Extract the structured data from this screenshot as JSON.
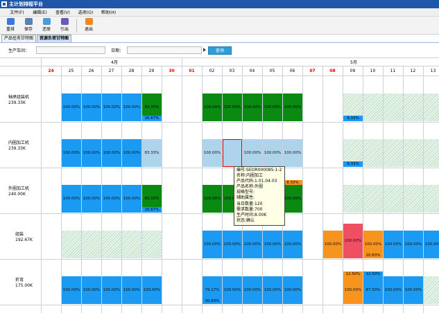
{
  "window": {
    "title": "主计划排程平台"
  },
  "menu": [
    "文件(F)",
    "编辑(E)",
    "查看(V)",
    "选项(O)",
    "帮助(H)"
  ],
  "toolbar": [
    {
      "label": "重排",
      "icon": "refresh-icon",
      "color": "#3a7bd5"
    },
    {
      "label": "保存",
      "icon": "save-icon",
      "color": "#5a7fb0"
    },
    {
      "label": "还原",
      "icon": "undo-icon",
      "color": "#4e9ad8"
    },
    {
      "label": "引出",
      "icon": "export-icon",
      "color": "#6a5ab8"
    },
    {
      "label": "退出",
      "icon": "exit-icon",
      "color": "#e88b2c"
    }
  ],
  "tabs": [
    {
      "label": "产品任务甘特图",
      "active": false
    },
    {
      "label": "资源负荷甘特图",
      "active": true
    }
  ],
  "filter": {
    "workshop_label": "生产车间：",
    "workshop_value": "",
    "date_label": "日期：",
    "date_value": "",
    "query_label": "查询"
  },
  "calendar": {
    "months": [
      {
        "label": "4月"
      },
      {
        "label": "5月"
      }
    ],
    "days": [
      {
        "label": "24",
        "red": true
      },
      {
        "label": "25",
        "red": false
      },
      {
        "label": "26",
        "red": false
      },
      {
        "label": "27",
        "red": false
      },
      {
        "label": "28",
        "red": false
      },
      {
        "label": "29",
        "red": false
      },
      {
        "label": "30",
        "red": true
      },
      {
        "label": "01",
        "red": true
      },
      {
        "label": "02",
        "red": false
      },
      {
        "label": "03",
        "red": false
      },
      {
        "label": "04",
        "red": false
      },
      {
        "label": "05",
        "red": false
      },
      {
        "label": "06",
        "red": false
      },
      {
        "label": "07",
        "red": true
      },
      {
        "label": "08",
        "red": true
      },
      {
        "label": "09",
        "red": false
      },
      {
        "label": "10",
        "red": false
      },
      {
        "label": "11",
        "red": false
      },
      {
        "label": "12",
        "red": false
      },
      {
        "label": "13",
        "red": false
      }
    ]
  },
  "machines": [
    {
      "name": "轴承组装机",
      "capacity": "239.33K",
      "cells": [
        {
          "day": 1,
          "type": "blue",
          "text": "100.00%"
        },
        {
          "day": 2,
          "type": "blue",
          "text": "100.00%"
        },
        {
          "day": 3,
          "type": "blue",
          "text": "100.00%"
        },
        {
          "day": 4,
          "type": "blue",
          "text": "100.00%"
        },
        {
          "day": 5,
          "type": "green",
          "text": "83.33%",
          "sub": {
            "type": "blue",
            "text": "16.67%"
          }
        },
        {
          "day": 8,
          "type": "green",
          "text": "100.00%"
        },
        {
          "day": 9,
          "type": "green",
          "text": "100.00%"
        },
        {
          "day": 10,
          "type": "green",
          "text": "100.00%"
        },
        {
          "day": 11,
          "type": "green",
          "text": "100.00%"
        },
        {
          "day": 12,
          "type": "green",
          "text": "100.00%"
        },
        {
          "day": 15,
          "type": "hatch",
          "text": "",
          "sub": {
            "type": "blue",
            "text": "9.33%"
          }
        },
        {
          "day": 16,
          "type": "hatch",
          "text": ""
        },
        {
          "day": 17,
          "type": "hatch",
          "text": ""
        },
        {
          "day": 18,
          "type": "hatch",
          "text": ""
        },
        {
          "day": 19,
          "type": "hatch",
          "text": ""
        }
      ]
    },
    {
      "name": "内圈加工机",
      "capacity": "239.33K",
      "cells": [
        {
          "day": 1,
          "type": "blue",
          "text": "100.00%"
        },
        {
          "day": 2,
          "type": "blue",
          "text": "100.00%"
        },
        {
          "day": 3,
          "type": "blue",
          "text": "100.00%"
        },
        {
          "day": 4,
          "type": "blue",
          "text": "100.00%"
        },
        {
          "day": 5,
          "type": "lightblue",
          "text": "83.33%"
        },
        {
          "day": 8,
          "type": "lightblue",
          "text": "100.00%"
        },
        {
          "day": 9,
          "type": "lightblue",
          "text": "",
          "selected": true
        },
        {
          "day": 10,
          "type": "lightblue",
          "text": "100.00%"
        },
        {
          "day": 11,
          "type": "lightblue",
          "text": "100.00%"
        },
        {
          "day": 12,
          "type": "lightblue",
          "text": "100.00%"
        },
        {
          "day": 15,
          "type": "hatch",
          "text": "",
          "sub": {
            "type": "blue",
            "text": "9.33%"
          }
        },
        {
          "day": 16,
          "type": "hatch",
          "text": ""
        },
        {
          "day": 17,
          "type": "hatch",
          "text": ""
        },
        {
          "day": 18,
          "type": "hatch",
          "text": ""
        },
        {
          "day": 19,
          "type": "hatch",
          "text": ""
        }
      ]
    },
    {
      "name": "外圈加工机",
      "capacity": "240.00K",
      "cells": [
        {
          "day": 1,
          "type": "blue",
          "text": "100.00%"
        },
        {
          "day": 2,
          "type": "blue",
          "text": "100.00%"
        },
        {
          "day": 3,
          "type": "blue",
          "text": "100.00%"
        },
        {
          "day": 4,
          "type": "blue",
          "text": "100.00%"
        },
        {
          "day": 5,
          "type": "green",
          "text": "83.33%",
          "sub": {
            "type": "blue",
            "text": "16.67%"
          }
        },
        {
          "day": 8,
          "type": "green",
          "text": "100.00%"
        },
        {
          "day": 9,
          "type": "green",
          "text": "100.00%"
        },
        {
          "day": 12,
          "type": "green",
          "text": "100.00%",
          "top": {
            "type": "orange",
            "text": "8.33%"
          }
        },
        {
          "day": 15,
          "type": "hatch",
          "text": ""
        },
        {
          "day": 16,
          "type": "hatch",
          "text": ""
        },
        {
          "day": 17,
          "type": "hatch",
          "text": ""
        },
        {
          "day": 18,
          "type": "hatch",
          "text": ""
        },
        {
          "day": 19,
          "type": "hatch",
          "text": ""
        }
      ]
    },
    {
      "name": "组装",
      "capacity": "192.67K",
      "cells": [
        {
          "day": 1,
          "type": "hatch",
          "text": ""
        },
        {
          "day": 2,
          "type": "hatch",
          "text": ""
        },
        {
          "day": 3,
          "type": "hatch",
          "text": ""
        },
        {
          "day": 4,
          "type": "hatch",
          "text": ""
        },
        {
          "day": 5,
          "type": "hatch",
          "text": ""
        },
        {
          "day": 8,
          "type": "blue",
          "text": "100.00%"
        },
        {
          "day": 9,
          "type": "blue",
          "text": "100.00%"
        },
        {
          "day": 10,
          "type": "blue",
          "text": "100.00%"
        },
        {
          "day": 11,
          "type": "blue",
          "text": "100.00%"
        },
        {
          "day": 12,
          "type": "blue",
          "text": "100.00%"
        },
        {
          "day": 14,
          "type": "orange",
          "text": "100.00%"
        },
        {
          "day": 15,
          "type": "red",
          "text": "100.00%",
          "tall": true
        },
        {
          "day": 16,
          "type": "orange",
          "text": "100.00%",
          "sub": {
            "type": "orange",
            "text": "20.83%"
          }
        },
        {
          "day": 17,
          "type": "blue",
          "text": "100.00%"
        },
        {
          "day": 18,
          "type": "blue",
          "text": "100.00%"
        },
        {
          "day": 19,
          "type": "blue",
          "text": "100.00%"
        }
      ]
    },
    {
      "name": "折弯",
      "capacity": "175.00K",
      "cells": [
        {
          "day": 1,
          "type": "blue",
          "text": "100.00%"
        },
        {
          "day": 2,
          "type": "blue",
          "text": "100.00%"
        },
        {
          "day": 3,
          "type": "blue",
          "text": "100.00%"
        },
        {
          "day": 4,
          "type": "blue",
          "text": "100.00%"
        },
        {
          "day": 5,
          "type": "blue",
          "text": "100.00%"
        },
        {
          "day": 8,
          "type": "blue",
          "text": "79.17%",
          "sub": {
            "type": "blue",
            "text": "20.83%"
          }
        },
        {
          "day": 9,
          "type": "blue",
          "text": "100.00%"
        },
        {
          "day": 10,
          "type": "blue",
          "text": "100.00%"
        },
        {
          "day": 11,
          "type": "blue",
          "text": "100.00%"
        },
        {
          "day": 12,
          "type": "blue",
          "text": "100.00%"
        },
        {
          "day": 15,
          "type": "orange",
          "text": "100.00%",
          "top": {
            "type": "orange",
            "text": "12.50%"
          }
        },
        {
          "day": 16,
          "type": "blue",
          "text": "87.50%",
          "top": {
            "type": "blue",
            "text": "12.50%"
          }
        },
        {
          "day": 17,
          "type": "blue",
          "text": "100.00%"
        },
        {
          "day": 18,
          "type": "blue",
          "text": "100.00%"
        },
        {
          "day": 19,
          "type": "hatch",
          "text": ""
        }
      ]
    }
  ],
  "tooltip": {
    "lines": [
      "编号:SEOR000085-1-2",
      "名称:内圈加工",
      "产品代码:1.01.04.03",
      "产品名称:外圈",
      "规格型号:",
      "辅助属性:",
      "当日数量:120",
      "需求数量:700",
      "生产时间:8.00K",
      "状态:确认"
    ]
  },
  "colors": {
    "title_bar": "#1f57a8",
    "load_full": "#1a9af2",
    "load_green": "#0b8a12",
    "load_light": "#aed4ec",
    "overload_orange": "#f7941d",
    "overload_red": "#ef4f62",
    "holiday_red": "#e00000"
  }
}
